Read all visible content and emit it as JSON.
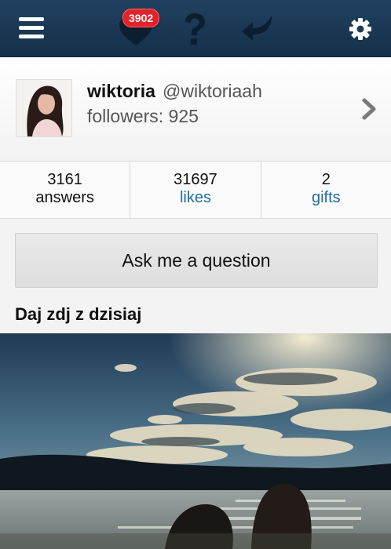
{
  "topbar": {
    "menu_icon": "hamburger-menu-icon",
    "notifications_icon": "heart-icon",
    "notifications_badge": "3902",
    "questions_icon": "question-mark-icon",
    "answers_icon": "reply-arrow-icon",
    "settings_icon": "gear-icon",
    "bar_color": "#1b3a57"
  },
  "profile": {
    "name": "wiktoria",
    "handle": "@wiktoriaah",
    "followers_text": "followers: 925",
    "chevron_icon": "chevron-right-icon"
  },
  "stats": [
    {
      "value": "3161",
      "label": "answers"
    },
    {
      "value": "31697",
      "label": "likes"
    },
    {
      "value": "2",
      "label": "gifts"
    }
  ],
  "ask_button": "Ask me a question",
  "question": {
    "text": "Daj zdj z dzisiaj"
  },
  "colors": {
    "badge": "#e3222a",
    "link": "#1f6ea3"
  }
}
